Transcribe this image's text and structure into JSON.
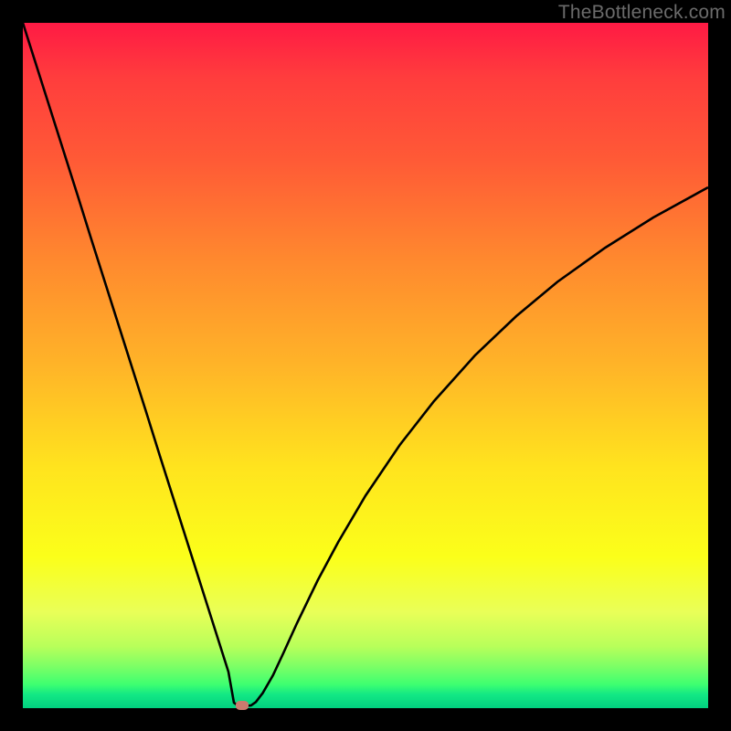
{
  "watermark": "TheBottleneck.com",
  "chart_data": {
    "type": "line",
    "title": "",
    "xlabel": "",
    "ylabel": "",
    "xlim": [
      0,
      100
    ],
    "ylim": [
      0,
      100
    ],
    "grid": false,
    "legend": false,
    "series": [
      {
        "name": "bottleneck-curve",
        "x": [
          0,
          2,
          4,
          6,
          8,
          10,
          12,
          14,
          16,
          18,
          20,
          22,
          24,
          26,
          28,
          30,
          30.8,
          31.5,
          32.3,
          33.3,
          34.0,
          35.0,
          36.5,
          38.0,
          40.0,
          43.0,
          46.0,
          50.0,
          55.0,
          60.0,
          66.0,
          72.0,
          78.0,
          85.0,
          92.0,
          100.0
        ],
        "y": [
          100,
          93.7,
          87.4,
          81.1,
          74.8,
          68.4,
          62.1,
          55.8,
          49.5,
          43.2,
          36.8,
          30.5,
          24.2,
          17.9,
          11.6,
          5.3,
          0.8,
          0.3,
          0.3,
          0.4,
          0.9,
          2.2,
          4.8,
          8.0,
          12.4,
          18.6,
          24.2,
          31.0,
          38.4,
          44.8,
          51.5,
          57.2,
          62.2,
          67.2,
          71.6,
          76.0
        ]
      }
    ],
    "marker": {
      "x": 32.0,
      "y": 0.35
    },
    "background_gradient": {
      "top": "#ff1a44",
      "upper_mid": "#ff8a2e",
      "mid": "#ffe41e",
      "lower_mid": "#b8ff5a",
      "bottom": "#01d180"
    }
  }
}
